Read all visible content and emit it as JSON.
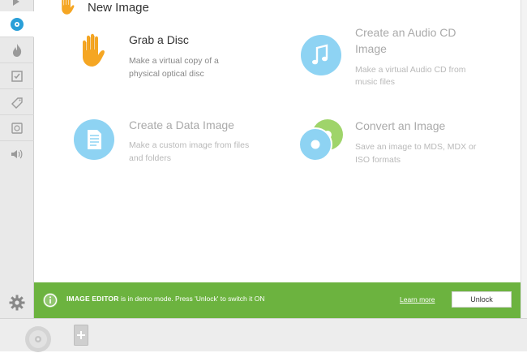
{
  "header": {
    "title": "New Image"
  },
  "sidebar": {
    "items": [
      {
        "name": "burn-icon"
      },
      {
        "name": "disc-image-icon",
        "active": true
      },
      {
        "name": "flame-icon"
      },
      {
        "name": "verify-icon"
      },
      {
        "name": "label-tag-icon"
      },
      {
        "name": "disc-info-icon"
      },
      {
        "name": "audio-icon"
      }
    ],
    "settings_icon": "gear-icon"
  },
  "options": [
    {
      "title": "Grab a Disc",
      "desc_line1": "Make a virtual copy of a",
      "desc_line2": "physical optical disc",
      "enabled": true,
      "icon": "hand-icon"
    },
    {
      "title_line1": "Create an Audio CD",
      "title_line2": "Image",
      "desc_line1": "Make a virtual Audio CD from",
      "desc_line2": "music files",
      "enabled": false,
      "icon": "music-note-icon"
    },
    {
      "title": "Create a Data Image",
      "desc_line1": "Make a custom image from files",
      "desc_line2": "and folders",
      "enabled": false,
      "icon": "document-icon"
    },
    {
      "title": "Convert an Image",
      "desc_line1": "Save an image to MDS, MDX or",
      "desc_line2": "ISO formats",
      "enabled": false,
      "icon": "convert-discs-icon"
    }
  ],
  "demo_bar": {
    "strong": "IMAGE EDITOR",
    "message": " is in demo mode. Press 'Unlock' to switch it ON",
    "learn_more": "Learn more",
    "unlock_label": "Unlock"
  },
  "colors": {
    "demo_bar": "#6cb33f",
    "accent_blue": "#2a9fd8",
    "icon_light_blue": "#8ed3f3",
    "hand_orange": "#f5a623",
    "convert_green": "#9fd46a"
  }
}
